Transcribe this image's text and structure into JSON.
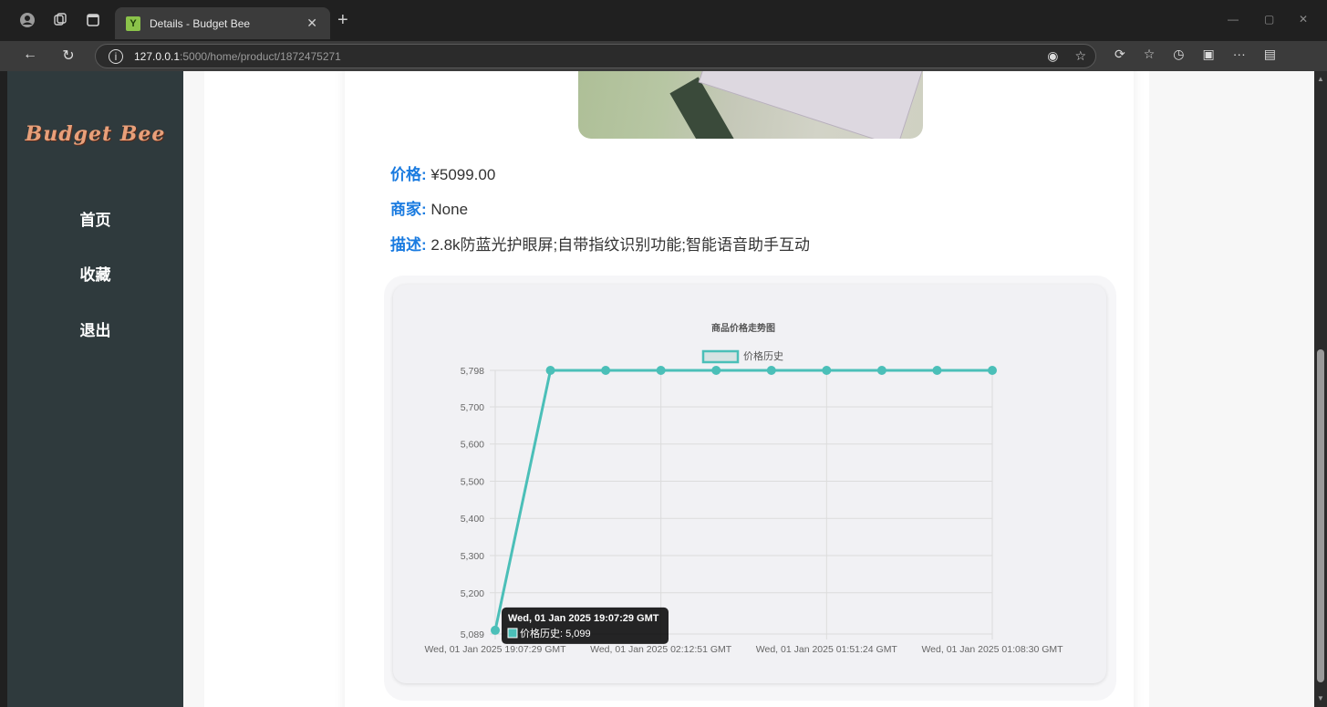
{
  "browser": {
    "tab_title": "Details - Budget Bee",
    "favicon_text": "Y",
    "url_host": "127.0.0.1",
    "url_path": ":5000/home/product/1872475271"
  },
  "sidebar": {
    "brand": "Budget Bee",
    "items": [
      {
        "label": "首页"
      },
      {
        "label": "收藏"
      },
      {
        "label": "退出"
      }
    ]
  },
  "product": {
    "price_label": "价格:",
    "price": "¥5099.00",
    "merchant_label": "商家:",
    "merchant": "None",
    "desc_label": "描述:",
    "desc": "2.8k防蓝光护眼屏;自带指纹识别功能;智能语音助手互动"
  },
  "colors": {
    "accent": "#1a7be0",
    "series": "#4bbfb8",
    "sidebar": "#2f3a3d"
  },
  "chart_data": {
    "type": "line",
    "title": "商品价格走势图",
    "series": [
      {
        "name": "价格历史",
        "values": [
          5099,
          5798,
          5798,
          5798,
          5798,
          5798,
          5798,
          5798,
          5798,
          5798
        ]
      }
    ],
    "x_tick_labels": [
      "Wed, 01 Jan 2025 19:07:29 GMT",
      "Wed, 01 Jan 2025 02:12:51 GMT",
      "Wed, 01 Jan 2025 01:51:24 GMT",
      "Wed, 01 Jan 2025 01:08:30 GMT"
    ],
    "y_ticks": [
      5089,
      5200,
      5300,
      5400,
      5500,
      5600,
      5700,
      5798
    ],
    "y_tick_labels": [
      "5,089",
      "5,200",
      "5,300",
      "5,400",
      "5,500",
      "5,600",
      "5,700",
      "5,798"
    ],
    "ylim": [
      5089,
      5798
    ],
    "grid": true,
    "legend": "top",
    "tooltip": {
      "title": "Wed, 01 Jan 2025 19:07:29 GMT",
      "body": "价格历史: 5,099"
    }
  }
}
